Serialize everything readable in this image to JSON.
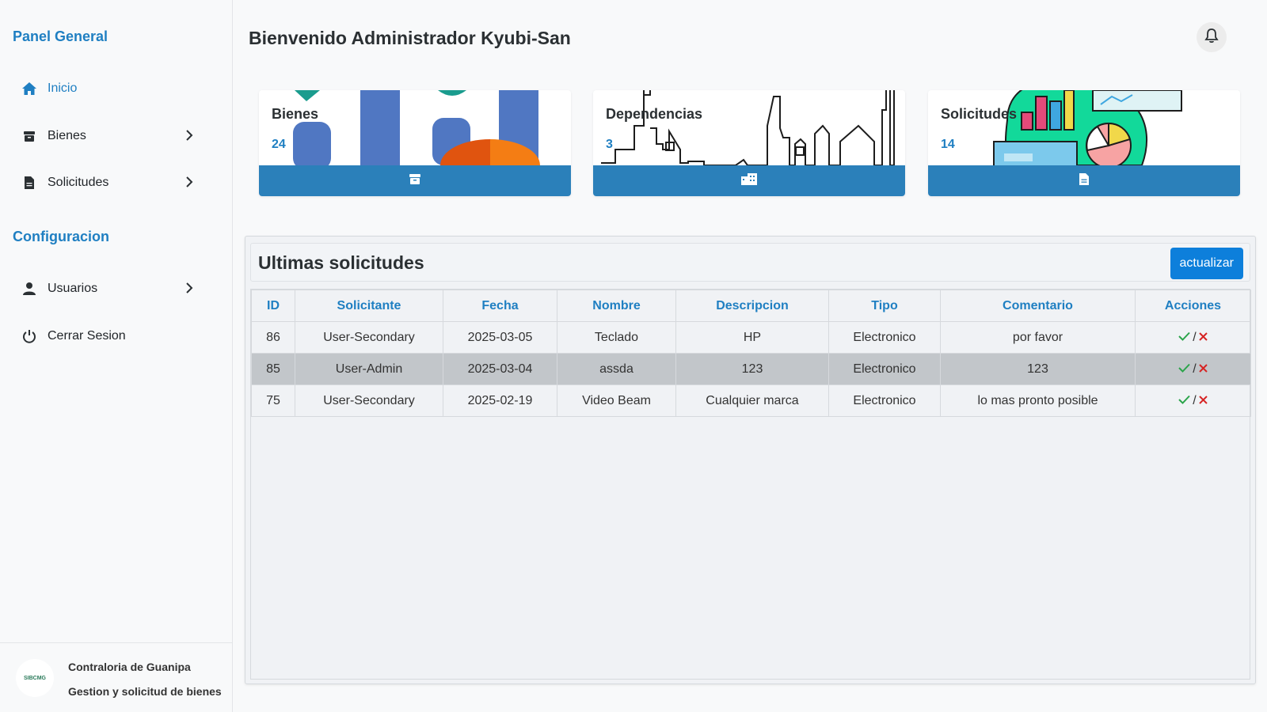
{
  "sidebar": {
    "heading_general": "Panel General",
    "heading_config": "Configuracion",
    "items": [
      {
        "label": "Inicio",
        "icon": "home-icon",
        "active": true
      },
      {
        "label": "Bienes",
        "icon": "archive-icon",
        "has_submenu": true
      },
      {
        "label": "Solicitudes",
        "icon": "file-icon",
        "has_submenu": true
      },
      {
        "label": "Usuarios",
        "icon": "user-icon",
        "has_submenu": true
      },
      {
        "label": "Cerrar Sesion",
        "icon": "power-icon"
      }
    ],
    "footer": {
      "logo_text": "SIBCMG",
      "line1": "Contraloria de Guanipa",
      "line2": "Gestion y solicitud de bienes"
    }
  },
  "header": {
    "title": "Bienvenido Administrador Kyubi-San",
    "notification_icon": "bell-icon"
  },
  "cards": [
    {
      "title": "Bienes",
      "count": "24",
      "icon": "archive-icon"
    },
    {
      "title": "Dependencias",
      "count": "3",
      "icon": "building-icon"
    },
    {
      "title": "Solicitudes",
      "count": "14",
      "icon": "file-icon"
    }
  ],
  "requests": {
    "title": "Ultimas solicitudes",
    "refresh_label": "actualizar",
    "columns": [
      "ID",
      "Solicitante",
      "Fecha",
      "Nombre",
      "Descripcion",
      "Tipo",
      "Comentario",
      "Acciones"
    ],
    "rows": [
      {
        "id": "86",
        "solicitante": "User-Secondary",
        "fecha": "2025-03-05",
        "nombre": "Teclado",
        "descripcion": "HP",
        "tipo": "Electronico",
        "comentario": "por favor"
      },
      {
        "id": "85",
        "solicitante": "User-Admin",
        "fecha": "2025-03-04",
        "nombre": "assda",
        "descripcion": "123",
        "tipo": "Electronico",
        "comentario": "123"
      },
      {
        "id": "75",
        "solicitante": "User-Secondary",
        "fecha": "2025-02-19",
        "nombre": "Video Beam",
        "descripcion": "Cualquier marca",
        "tipo": "Electronico",
        "comentario": "lo mas pronto posible"
      }
    ],
    "action_approve_icon": "check-icon",
    "action_separator": "/",
    "action_reject_icon": "x-icon"
  },
  "colors": {
    "brand": "#1f7fc2",
    "card_bar": "#2b80ba",
    "button": "#0d7fdb",
    "approve": "#2aa44a",
    "reject": "#d62424",
    "highlight_row": "#c2c6ca"
  }
}
